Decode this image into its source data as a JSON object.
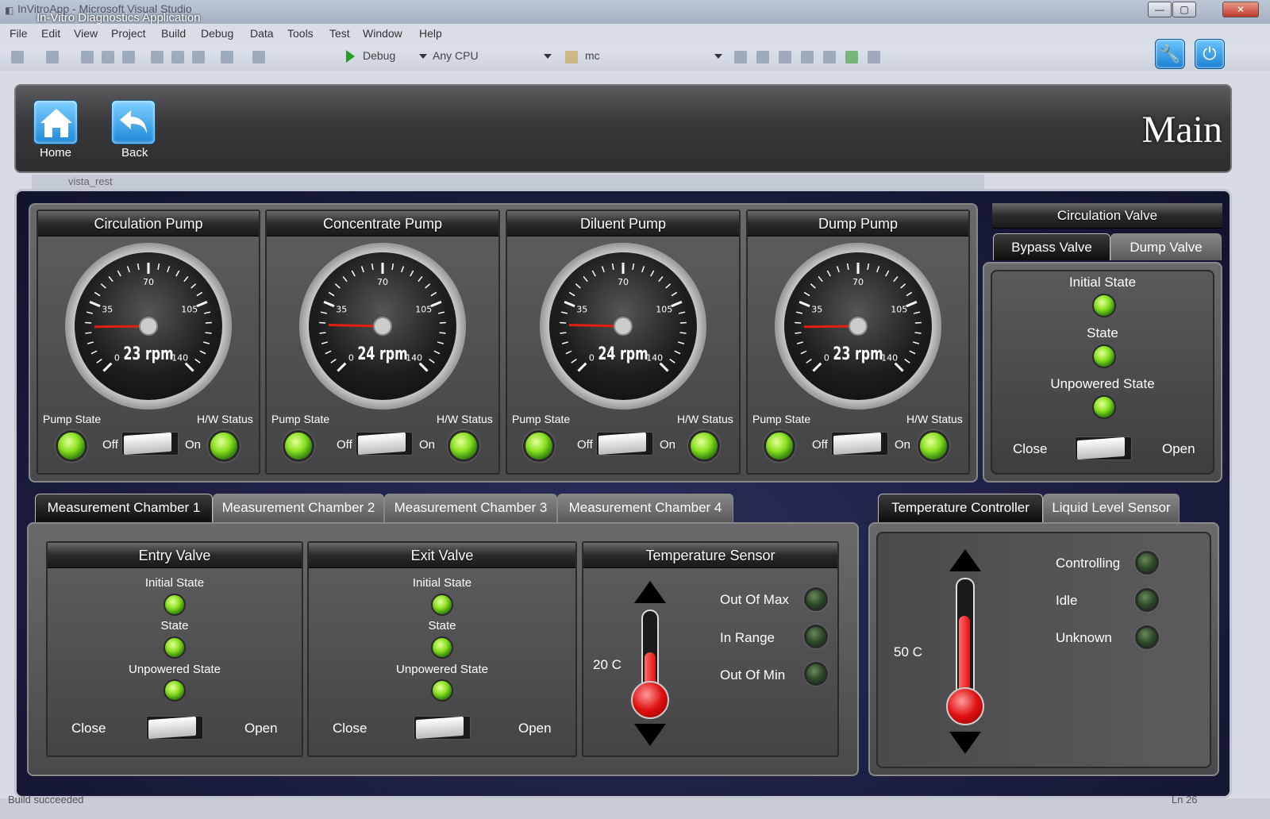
{
  "window": {
    "title_bg": "InVitroApp - Microsoft Visual Studio",
    "title_app": "In-Vitro Diagnostics Application",
    "min": "—",
    "max": "▢",
    "close": "✕"
  },
  "menu": [
    "File",
    "Edit",
    "View",
    "Project",
    "Build",
    "Debug",
    "Data",
    "Tools",
    "Test",
    "Window",
    "Help"
  ],
  "toolbar": {
    "config": "Debug",
    "platform": "Any CPU",
    "target": "mc"
  },
  "header": {
    "home_label": "Home",
    "back_label": "Back",
    "page_title": "Main",
    "ghost_tab": "vista_rest"
  },
  "pumps": [
    {
      "name": "Circulation Pump",
      "rpm": "23 rpm",
      "value": 23
    },
    {
      "name": "Concentrate Pump",
      "rpm": "24 rpm",
      "value": 24
    },
    {
      "name": "Diluent Pump",
      "rpm": "24 rpm",
      "value": 24
    },
    {
      "name": "Dump Pump",
      "rpm": "23 rpm",
      "value": 23
    }
  ],
  "gauge_ticks": [
    "0",
    "35",
    "70",
    "105",
    "140"
  ],
  "pump_labels": {
    "state": "Pump State",
    "hw": "H/W Status",
    "off": "Off",
    "on": "On"
  },
  "circ_valve": {
    "title": "Circulation Valve",
    "tabs": [
      "Bypass Valve",
      "Dump Valve"
    ],
    "initial": "Initial State",
    "state": "State",
    "unpowered": "Unpowered State",
    "close": "Close",
    "open": "Open"
  },
  "chamber_tabs": [
    "Measurement Chamber 1",
    "Measurement Chamber 2",
    "Measurement Chamber 3",
    "Measurement Chamber 4"
  ],
  "entry_valve": {
    "title": "Entry Valve",
    "initial": "Initial State",
    "state": "State",
    "unpowered": "Unpowered State",
    "close": "Close",
    "open": "Open"
  },
  "exit_valve": {
    "title": "Exit Valve",
    "initial": "Initial State",
    "state": "State",
    "unpowered": "Unpowered State",
    "close": "Close",
    "open": "Open"
  },
  "temp_sensor": {
    "title": "Temperature Sensor",
    "value": "20 C",
    "out_max": "Out Of Max",
    "in_range": "In Range",
    "out_min": "Out Of Min"
  },
  "right_tabs": [
    "Temperature Controller",
    "Liquid Level Sensor"
  ],
  "temp_ctrl": {
    "value": "50 C",
    "controlling": "Controlling",
    "idle": "Idle",
    "unknown": "Unknown"
  },
  "status": {
    "left": "Build succeeded",
    "right": "Ln 26"
  }
}
